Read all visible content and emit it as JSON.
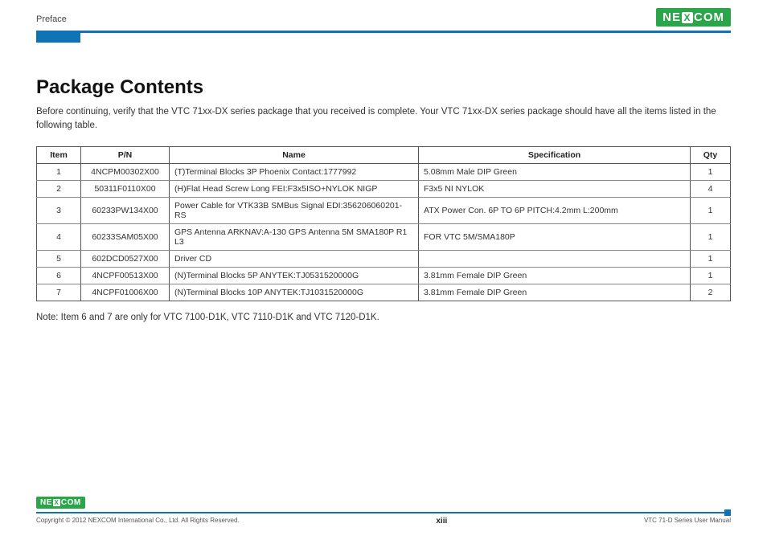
{
  "brand": "NEXCOM",
  "header": {
    "section": "Preface"
  },
  "page": {
    "title": "Package Contents",
    "intro": "Before continuing, verify that the VTC 71xx-DX series package that you received is complete. Your VTC 71xx-DX series package should have all the items listed in the following table.",
    "note": "Note: Item 6 and 7 are only for VTC 7100-D1K, VTC 7110-D1K and VTC 7120-D1K."
  },
  "table": {
    "headers": {
      "item": "Item",
      "pn": "P/N",
      "name": "Name",
      "spec": "Specification",
      "qty": "Qty"
    },
    "rows": [
      {
        "item": "1",
        "pn": "4NCPM00302X00",
        "name": "(T)Terminal Blocks 3P Phoenix Contact:1777992",
        "spec": "5.08mm Male DIP Green",
        "qty": "1"
      },
      {
        "item": "2",
        "pn": "50311F0110X00",
        "name": "(H)Flat Head Screw Long FEI:F3x5ISO+NYLOK NIGP",
        "spec": "F3x5 NI NYLOK",
        "qty": "4"
      },
      {
        "item": "3",
        "pn": "60233PW134X00",
        "name": "Power Cable for VTK33B SMBus Signal EDI:356206060201-RS",
        "spec": "ATX Power Con. 6P TO 6P PITCH:4.2mm L:200mm",
        "qty": "1"
      },
      {
        "item": "4",
        "pn": "60233SAM05X00",
        "name": "GPS Antenna ARKNAV:A-130 GPS Antenna 5M SMA180P R1 L3",
        "spec": "FOR VTC 5M/SMA180P",
        "qty": "1"
      },
      {
        "item": "5",
        "pn": "602DCD0527X00",
        "name": "Driver CD",
        "spec": "",
        "qty": "1"
      },
      {
        "item": "6",
        "pn": "4NCPF00513X00",
        "name": "(N)Terminal Blocks 5P ANYTEK:TJ0531520000G",
        "spec": "3.81mm Female DIP Green",
        "qty": "1"
      },
      {
        "item": "7",
        "pn": "4NCPF01006X00",
        "name": "(N)Terminal Blocks 10P ANYTEK:TJ1031520000G",
        "spec": "3.81mm Female DIP Green",
        "qty": "2"
      }
    ]
  },
  "footer": {
    "copyright": "Copyright © 2012 NEXCOM International Co., Ltd. All Rights Reserved.",
    "page_num": "xiii",
    "doc": "VTC 71-D Series User Manual"
  }
}
